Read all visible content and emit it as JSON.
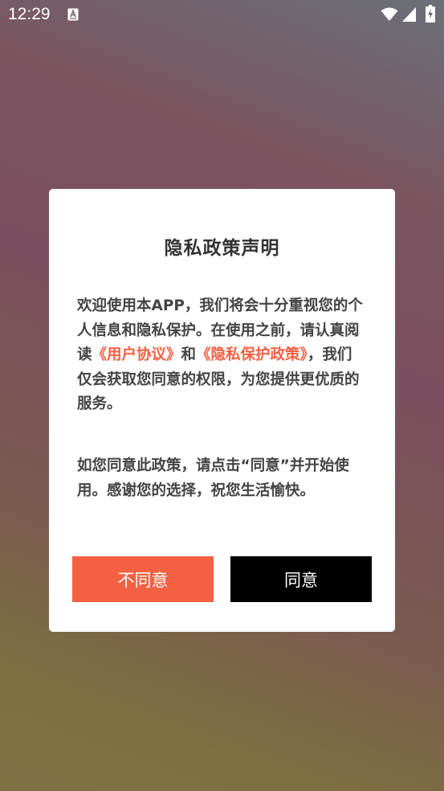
{
  "status_bar": {
    "time": "12:29"
  },
  "dialog": {
    "title": "隐私政策声明",
    "para1": {
      "intro": "欢迎使用本APP，我们将会十分重视您的个人信息和隐私保护。在使用之前，请认真阅读",
      "user_agreement_link": "《用户协议》",
      "and": "和",
      "privacy_policy_link": "《隐私保护政策》",
      "outro": "，我们仅会获取您同意的权限，为您提供更优质的服务。"
    },
    "para2": "如您同意此政策，请点击“同意”并开始使用。感谢您的选择，祝您生活愉快。",
    "disagree_label": "不同意",
    "agree_label": "同意"
  },
  "colors": {
    "accent": "#f46042",
    "agree_button": "#000000",
    "dialog_bg": "#ffffff"
  },
  "icons": [
    "notification-icon",
    "wifi-icon",
    "signal-icon",
    "battery-charging-icon"
  ]
}
